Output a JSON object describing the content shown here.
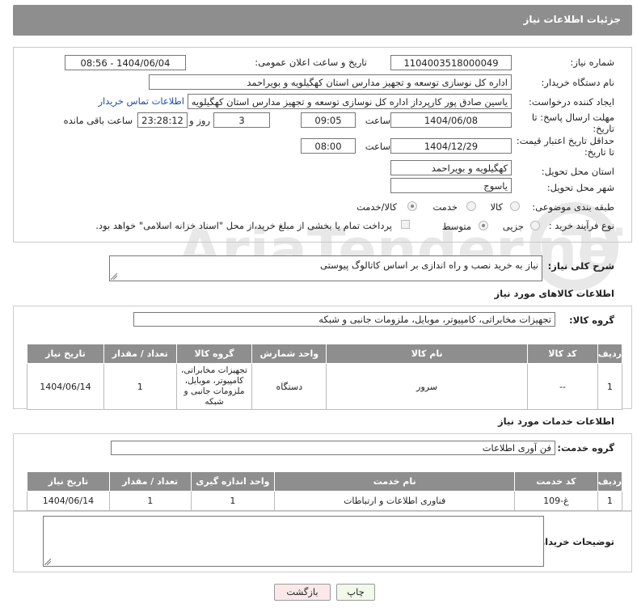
{
  "header": {
    "title": "جزئیات اطلاعات نیاز"
  },
  "form": {
    "need_number_label": "شماره نیاز:",
    "need_number": "1104003518000049",
    "announce_label": "تاریخ و ساعت اعلان عمومی:",
    "announce_value": "1404/06/04 - 08:56",
    "buyer_org_label": "نام دستگاه خریدار:",
    "buyer_org": "اداره کل نوسازی  توسعه و تجهیز مدارس استان کهگیلویه و بویراحمد",
    "requester_label": "ایجاد کننده درخواست:",
    "requester": "یاسین صادق پور کارپرداز اداره کل نوسازی  توسعه و تجهیز مدارس استان کهگیلویه",
    "contact_link": "اطلاعات تماس خریدار",
    "deadline_label_1": "مهلت ارسال پاسخ: تا",
    "deadline_label_2": "تاریخ:",
    "deadline_date": "1404/06/08",
    "time_label": "ساعت",
    "deadline_time": "09:05",
    "days_value": "3",
    "days_label": "روز و",
    "remaining_time": "23:28:12",
    "remaining_label": "ساعت باقی مانده",
    "validity_label_1": "حداقل تاریخ اعتبار قیمت:",
    "validity_label_2": "تا تاریخ:",
    "validity_date": "1404/12/29",
    "validity_time": "08:00",
    "province_label": "استان محل تحویل:",
    "province": "کهگیلویه و بویراحمد",
    "city_label": "شهر محل تحویل:",
    "city": "یاسوج",
    "category_label": "طبقه بندی موضوعی:",
    "category_options": [
      "کالا",
      "خدمت",
      "کالا/خدمت"
    ],
    "process_label": "نوع فرآیند خرید :",
    "process_options": [
      "جزیی",
      "متوسط"
    ],
    "payment_note": "پرداخت تمام یا بخشی از مبلغ خرید،از محل \"اسناد خزانه اسلامی\" خواهد بود."
  },
  "description": {
    "label": "شرح کلی نیاز:",
    "value": "نیاز به خرید نصب و راه اندازی بر اساس کاتالوگ پیوستی"
  },
  "goods": {
    "section_title": "اطلاعات کالاهای مورد نیاز",
    "group_label": "گروه کالا:",
    "group_value": "تجهیزات مخابراتی، کامپیوتر، موبایل، ملزومات جانبی و شبکه",
    "columns": [
      "ردیف",
      "کد کالا",
      "نام کالا",
      "واحد شمارش",
      "گروه کالا",
      "تعداد / مقدار",
      "تاریخ نیاز"
    ],
    "rows": [
      {
        "row": "1",
        "code": "--",
        "name": "سرور",
        "unit": "دستگاه",
        "group": "تجهیزات مخابراتی، کامپیوتر، موبایل، ملزومات جانبی و شبکه",
        "qty": "1",
        "date": "1404/06/14"
      }
    ]
  },
  "services": {
    "section_title": "اطلاعات خدمات مورد نیاز",
    "group_label": "گروه خدمت:",
    "group_value": "فن آوری اطلاعات",
    "columns": [
      "ردیف",
      "کد خدمت",
      "نام خدمت",
      "واحد اندازه گیری",
      "تعداد / مقدار",
      "تاریخ نیاز"
    ],
    "rows": [
      {
        "row": "1",
        "code": "غ-109",
        "name": "فناوری اطلاعات و ارتباطات",
        "unit": "1",
        "qty": "1",
        "date": "1404/06/14"
      }
    ]
  },
  "buyer_notes": {
    "label": "توضیحات خریدار:",
    "value": ""
  },
  "buttons": {
    "print": "چاپ",
    "back": "بازگشت"
  },
  "watermark": "AriaTender.neT"
}
